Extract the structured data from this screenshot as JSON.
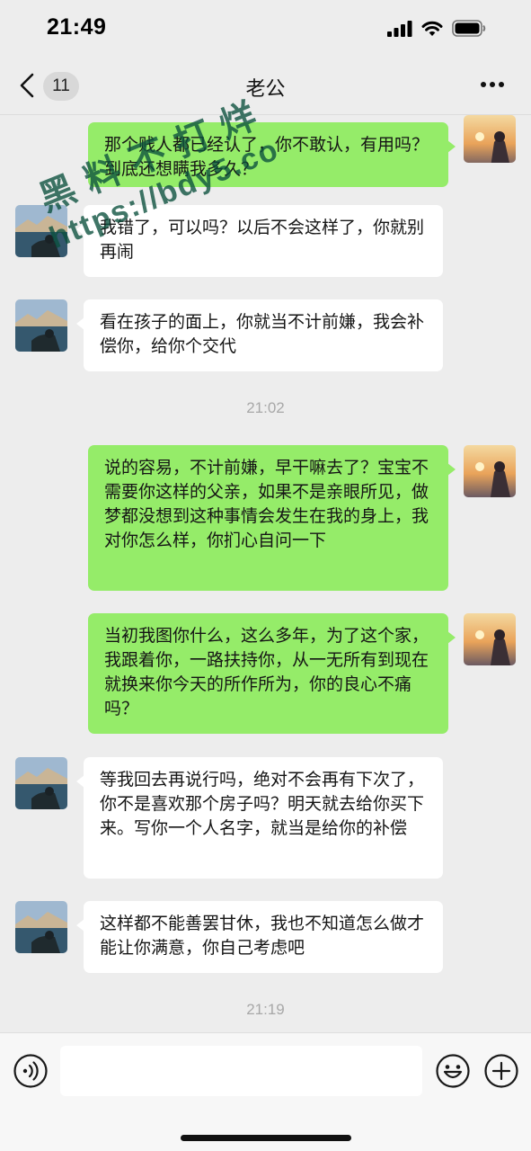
{
  "status_bar": {
    "time": "21:49"
  },
  "nav": {
    "title": "老公",
    "unread_count": "11"
  },
  "messages": [
    {
      "from": "me",
      "text": "那个贱人都已经认了，你不敢认，有用吗？到底还想瞒我多久？"
    },
    {
      "from": "other",
      "text": "我错了，可以吗？以后不会这样了，你就别再闹"
    },
    {
      "from": "other",
      "text": "看在孩子的面上，你就当不计前嫌，我会补偿你，给你个交代"
    },
    {
      "from": "me",
      "text": "说的容易，不计前嫌，早干嘛去了？宝宝不需要你这样的父亲，如果不是亲眼所见，做梦都没想到这种事情会发生在我的身上，我对你怎么样，你扪心自问一下"
    },
    {
      "from": "me",
      "text": "当初我图你什么，这么多年，为了这个家，我跟着你，一路扶持你，从一无所有到现在就换来你今天的所作所为，你的良心不痛吗？"
    },
    {
      "from": "other",
      "text": "等我回去再说行吗，绝对不会再有下次了，你不是喜欢那个房子吗？明天就去给你买下来。写你一个人名字，就当是给你的补偿"
    },
    {
      "from": "other",
      "text": "这样都不能善罢甘休，我也不知道怎么做才能让你满意，你自己考虑吧"
    }
  ],
  "timestamps": [
    "21:02",
    "21:19"
  ],
  "watermark": {
    "line1": "黑料不打烊",
    "line2": "https://bdy5.co"
  },
  "input": {
    "value": ""
  },
  "colors": {
    "bubble_me": "#95ec69",
    "bubble_other": "#ffffff",
    "background": "#ededed"
  },
  "icons": [
    "chevron-left-icon",
    "more-icon",
    "voice-icon",
    "emoji-icon",
    "plus-icon",
    "signal-icon",
    "wifi-icon",
    "battery-icon"
  ]
}
